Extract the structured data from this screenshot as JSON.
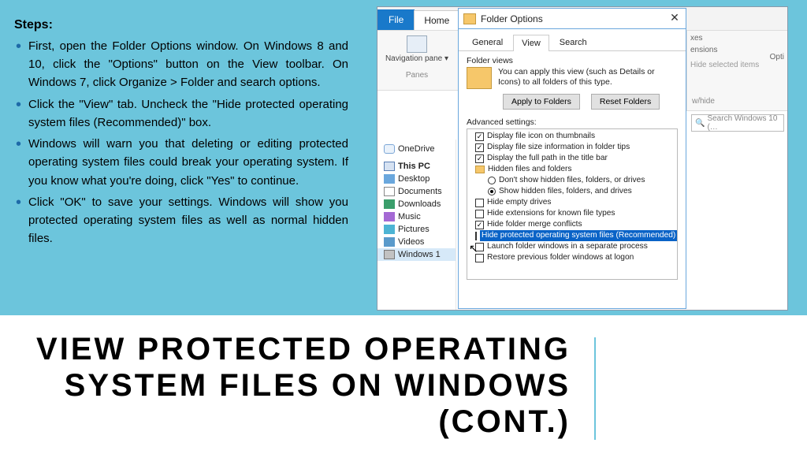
{
  "steps": {
    "heading": "Steps:",
    "items": [
      "First, open the Folder Options window. On Windows 8 and 10, click the \"Options\" button on the View toolbar. On Windows 7, click Organize > Folder and search options.",
      "Click the \"View\" tab. Uncheck the \"Hide protected operating system files (Recommended)\" box.",
      "Windows will warn you that deleting or editing protected operating system files could break your operating system. If you know what you're doing, click \"Yes\" to continue.",
      "Click \"OK\" to save your settings. Windows will show you protected operating system files as well as normal hidden files."
    ]
  },
  "explorer": {
    "file_tab": "File",
    "home_tab": "Home",
    "nav_pane": "Navigation pane ▾",
    "panes_group": "Panes",
    "right": {
      "boxes": "xes",
      "ensions": "ensions",
      "hide_selected": "Hide selected items",
      "opti": "Opti",
      "whide": "w/hide"
    },
    "search_placeholder": "Search Windows 10 (…",
    "tree": [
      "OneDrive",
      "This PC",
      "Desktop",
      "Documents",
      "Downloads",
      "Music",
      "Pictures",
      "Videos",
      "Windows 1"
    ]
  },
  "dialog": {
    "title": "Folder Options",
    "close": "✕",
    "tabs": [
      "General",
      "View",
      "Search"
    ],
    "fv_heading": "Folder views",
    "fv_text": "You can apply this view (such as Details or Icons) to all folders of this type.",
    "apply_btn": "Apply to Folders",
    "reset_btn": "Reset Folders",
    "adv_label": "Advanced settings:",
    "rows": {
      "r0": "Display file icon on thumbnails",
      "r1": "Display file size information in folder tips",
      "r2": "Display the full path in the title bar",
      "r3": "Hidden files and folders",
      "r4": "Don't show hidden files, folders, or drives",
      "r5": "Show hidden files, folders, and drives",
      "r6": "Hide empty drives",
      "r7": "Hide extensions for known file types",
      "r8": "Hide folder merge conflicts",
      "r9": "Hide protected operating system files (Recommended)",
      "r10": "Launch folder windows in a separate process",
      "r11": "Restore previous folder windows at logon"
    }
  },
  "title": {
    "l1": "VIEW PROTECTED OPERATING",
    "l2": "SYSTEM FILES ON WINDOWS",
    "l3": "(CONT.)"
  }
}
